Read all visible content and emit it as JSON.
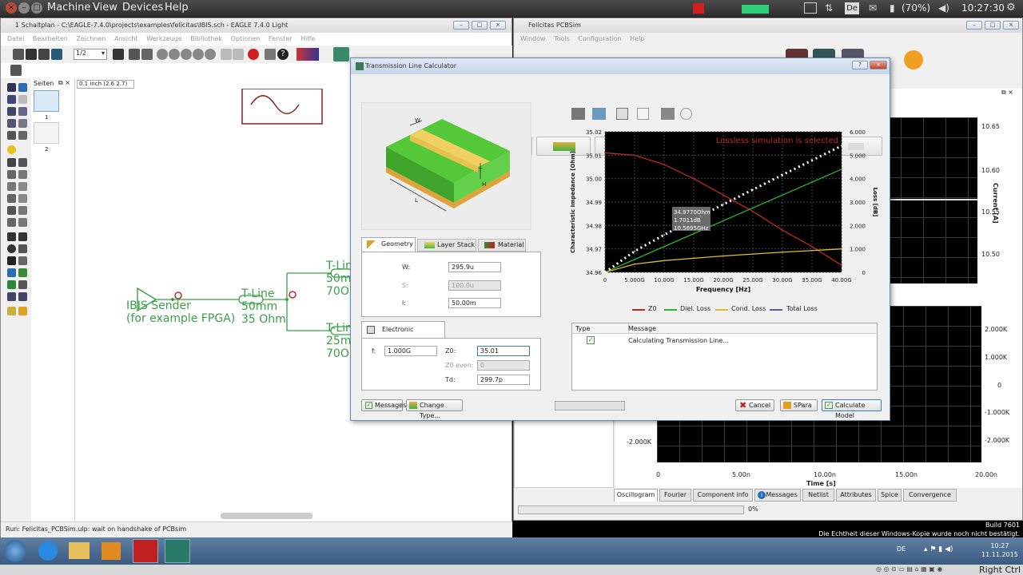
{
  "vbox": {
    "menu": [
      "Machine",
      "View",
      "Devices",
      "Help"
    ],
    "lang": "De",
    "battery": "(70%)",
    "clock": "10:27:30",
    "right_ctrl": "Right Ctrl"
  },
  "eagle": {
    "title": "1 Schaltplan - C:\\EAGLE-7.4.0\\projects\\examples\\felicitas\\IBIS.sch - EAGLE 7.4.0 Light",
    "menu": [
      "Datei",
      "Bearbeiten",
      "Zeichnen",
      "Ansicht",
      "Werkzeuge",
      "Bibliothek",
      "Optionen",
      "Fenster",
      "Hilfe"
    ],
    "zoom": "1/2",
    "sheets_label": "Seiten",
    "grid_value": "0.1 inch (2.6 2.7)",
    "sheet1": "1",
    "sheet2": "2",
    "status": "Run: Felicitas_PCBSim.ulp: wait on handshake of PCBsim",
    "schematic": {
      "sender_l1": "IBIS Sender",
      "sender_l2": "(for example FPGA)",
      "t1_l1": "T-Line",
      "t1_l2": "50mm",
      "t1_l3": "35 Ohm",
      "t2_l1": "T-Lin",
      "t2_l2": "50mm",
      "t2_l3": "70Oh",
      "t3_l1": "T-Lin",
      "t3_l2": "25mm",
      "t3_l3": "70Oh"
    }
  },
  "pcbsim": {
    "title": "Felicitas PCBSim",
    "menu": [
      "Window",
      "Tools",
      "Configuration",
      "Help"
    ],
    "tabs": [
      "Oscillogram",
      "Fourier",
      "Component info",
      "Messages",
      "Netlist",
      "Attributes",
      "Spice",
      "Convergence"
    ],
    "progress": "0%",
    "upper_axis": {
      "ticks": [
        "10.65",
        "10.60",
        "10.55",
        "10.50"
      ],
      "label": "Current [A]"
    },
    "lower_axis": {
      "left_ticks": [
        "-2.000K"
      ],
      "right_ticks": [
        "2.000K",
        "1.000K",
        "0",
        "-1.000K",
        "-2.000K"
      ],
      "x_ticks": [
        "0",
        "5.00n",
        "10.00n",
        "15.00n",
        "20.00n"
      ],
      "xlabel": "Time [s]"
    },
    "build": "Build 7601",
    "activation": "Die Echtheit dieser Windows-Kopie wurde noch nicht bestätigt."
  },
  "dialog": {
    "title": "Transmission Line Calculator",
    "geo_tabs": [
      "Geometry",
      "Layer Stack",
      "Material"
    ],
    "geo_fields": [
      {
        "label": "W:",
        "value": "295.9u"
      },
      {
        "label": "S:",
        "value": "100.0u"
      },
      {
        "label": "l:",
        "value": "50.00m"
      }
    ],
    "elec_tab": "Electronic Properties",
    "f_label": "f:",
    "f_value": "1.000G",
    "z0_label": "Z0:",
    "z0_value": "35.01",
    "z0even_label": "Z0 even:",
    "z0even_value": "0",
    "td_label": "Td:",
    "td_value": "299.7p",
    "msg_headers": [
      "Type",
      "Message"
    ],
    "msg_text": "Calculating Transmission Line...",
    "buttons": {
      "messages": "Messages",
      "change_type": "Change Type...",
      "cancel": "Cancel",
      "spara": "SPara",
      "calculate": "Calculate Model"
    },
    "figure_labels": {
      "w": "W",
      "t": "T",
      "h": "H",
      "l": "L"
    }
  },
  "chart_data": {
    "type": "line",
    "note": "Lossless simulation is selected",
    "xlabel": "Frequency [Hz]",
    "ylabel": "Characteristic Impedance [Ohm]",
    "y2label": "Loss [dB]",
    "x_ticks": [
      "0",
      "5.000G",
      "10.00G",
      "15.00G",
      "20.00G",
      "25.00G",
      "30.00G",
      "35.00G",
      "40.00G"
    ],
    "y_ticks": [
      "35.02",
      "35.01",
      "35.00",
      "34.99",
      "34.98",
      "34.97",
      "34.96"
    ],
    "y2_ticks": [
      "6.000",
      "5.000",
      "4.000",
      "3.000",
      "2.000",
      "1.000",
      "0"
    ],
    "xlim": [
      0,
      40
    ],
    "ylim": [
      34.96,
      35.02
    ],
    "y2lim": [
      0,
      6
    ],
    "tooltip": [
      "34.9770Ohm",
      "1.7011dB",
      "10.5695GHz"
    ],
    "series": [
      {
        "name": "Z0",
        "color": "#c0281e",
        "axis": "left",
        "x": [
          0,
          5,
          10,
          15,
          20,
          25,
          30,
          35,
          40
        ],
        "values": [
          35.011,
          35.01,
          35.006,
          35.0,
          34.993,
          34.986,
          34.978,
          34.971,
          34.963
        ]
      },
      {
        "name": "Diel. Loss",
        "color": "#2db52d",
        "axis": "right",
        "x": [
          0,
          5,
          10,
          15,
          20,
          25,
          30,
          35,
          40
        ],
        "values": [
          0,
          0.55,
          1.1,
          1.65,
          2.2,
          2.75,
          3.3,
          3.85,
          4.4
        ]
      },
      {
        "name": "Cond. Loss",
        "color": "#e0c020",
        "axis": "right",
        "x": [
          0,
          5,
          10,
          15,
          20,
          25,
          30,
          35,
          40
        ],
        "values": [
          0,
          0.35,
          0.5,
          0.6,
          0.7,
          0.78,
          0.86,
          0.93,
          1.0
        ]
      },
      {
        "name": "Total Loss",
        "color": "#ffffff",
        "axis": "right",
        "dotted": true,
        "x": [
          0,
          5,
          10,
          15,
          20,
          25,
          30,
          35,
          40
        ],
        "values": [
          0,
          0.9,
          1.6,
          2.25,
          2.9,
          3.53,
          4.16,
          4.78,
          5.4
        ]
      }
    ]
  },
  "taskbar": {
    "lang": "DE",
    "time": "10:27",
    "date": "11.11.2015"
  }
}
